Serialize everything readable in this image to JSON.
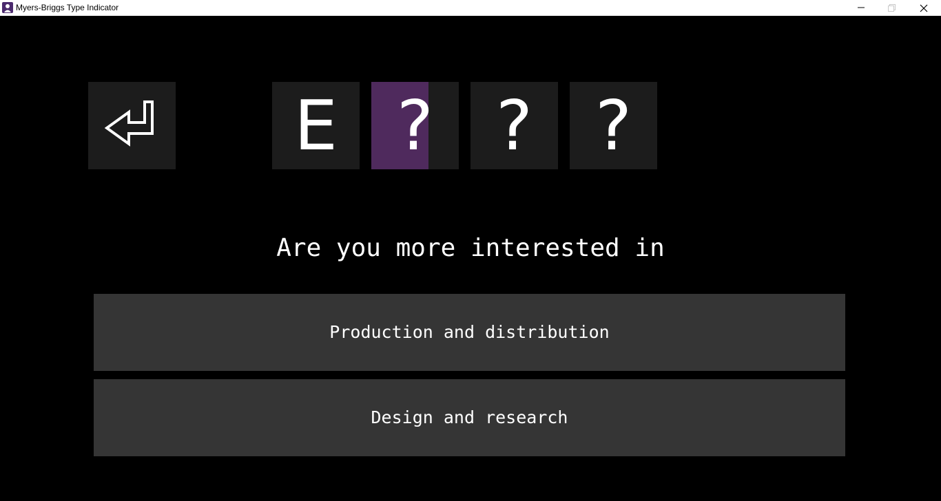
{
  "window": {
    "title": "Myers-Briggs Type Indicator"
  },
  "type_indicator": {
    "letters": [
      "E",
      "?",
      "?",
      "?"
    ],
    "active_index": 1,
    "active_progress": 0.65
  },
  "question": {
    "text": "Are you more interested in"
  },
  "answers": [
    {
      "label": "Production and distribution"
    },
    {
      "label": "Design and research"
    }
  ],
  "colors": {
    "background": "#000000",
    "tile": "#1c1c1c",
    "accent": "#4f2a5d",
    "answer_button": "#353535",
    "text": "#ffffff"
  },
  "icons": {
    "app": "mbti-app-icon",
    "back": "return-arrow-icon",
    "minimize": "minimize-icon",
    "maximize": "maximize-icon",
    "close": "close-icon"
  }
}
